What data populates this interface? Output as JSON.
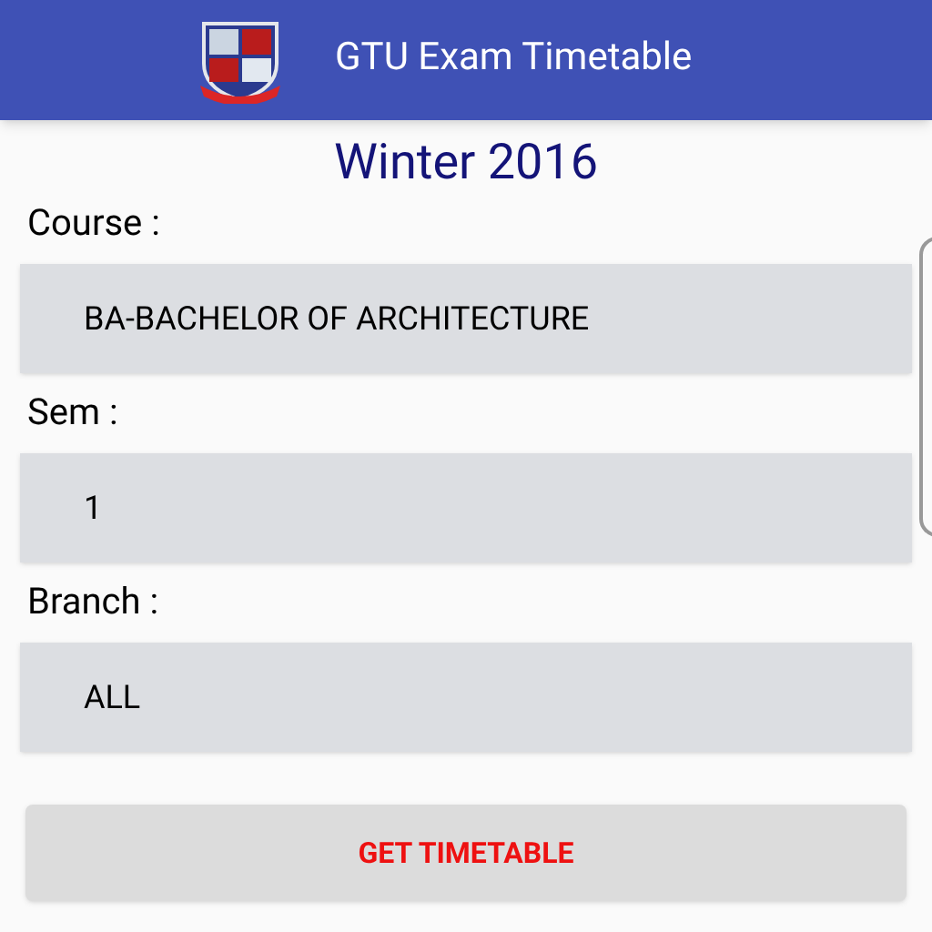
{
  "app_bar": {
    "title": "GTU Exam Timetable"
  },
  "heading": "Winter 2016",
  "fields": [
    {
      "label": "Course :",
      "value": "BA-BACHELOR OF ARCHITECTURE"
    },
    {
      "label": "Sem :",
      "value": "1"
    },
    {
      "label": "Branch :",
      "value": "ALL"
    }
  ],
  "button": "GET TIMETABLE"
}
